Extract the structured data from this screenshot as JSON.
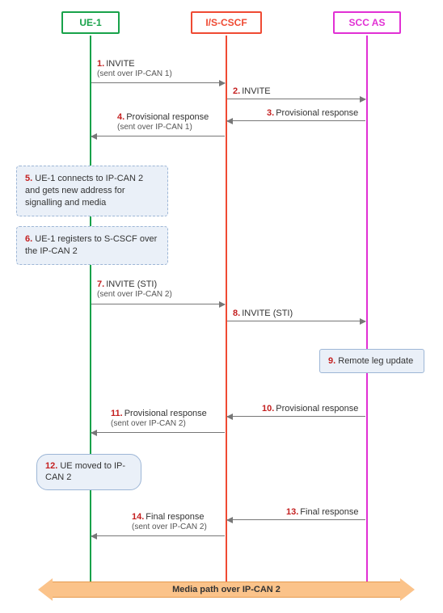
{
  "actors": {
    "ue1": {
      "label": "UE-1"
    },
    "cscf": {
      "label": "I/S-CSCF"
    },
    "scc": {
      "label": "SCC AS"
    }
  },
  "messages": {
    "m1": {
      "num": "1.",
      "text": "INVITE",
      "sub": "(sent over IP-CAN 1)"
    },
    "m2": {
      "num": "2.",
      "text": "INVITE"
    },
    "m3": {
      "num": "3.",
      "text": "Provisional response"
    },
    "m4": {
      "num": "4.",
      "text": "Provisional response",
      "sub": "(sent over IP-CAN 1)"
    },
    "n5": {
      "num": "5.",
      "text": "UE-1 connects to IP-CAN 2 and gets new address for signalling and media"
    },
    "n6": {
      "num": "6.",
      "text": "UE-1 registers to S-CSCF over the IP-CAN 2"
    },
    "m7": {
      "num": "7.",
      "text": "INVITE (STI)",
      "sub": "(sent over IP-CAN 2)"
    },
    "m8": {
      "num": "8.",
      "text": "INVITE (STI)"
    },
    "n9": {
      "num": "9.",
      "text": "Remote leg update"
    },
    "m10": {
      "num": "10.",
      "text": "Provisional response"
    },
    "m11": {
      "num": "11.",
      "text": "Provisional response",
      "sub": "(sent over IP-CAN 2)"
    },
    "n12": {
      "num": "12.",
      "text": "UE moved to IP-CAN 2"
    },
    "m13": {
      "num": "13.",
      "text": "Final response"
    },
    "m14": {
      "num": "14.",
      "text": "Final response",
      "sub": "(sent over IP-CAN 2)"
    }
  },
  "media_path": {
    "text": "Media path over IP-CAN 2"
  }
}
